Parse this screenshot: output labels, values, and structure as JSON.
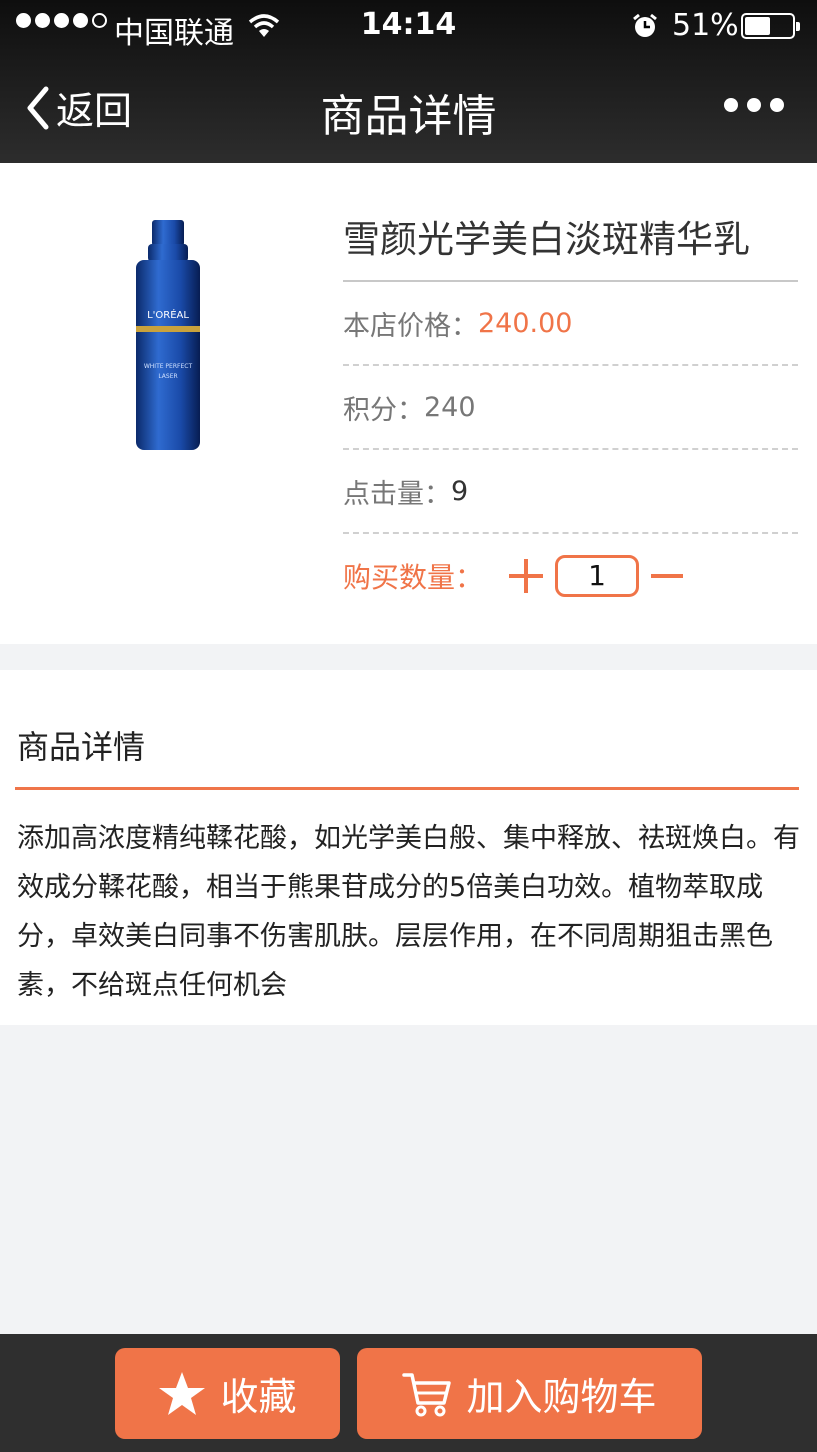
{
  "status_bar": {
    "carrier": "中国联通",
    "time": "14:14",
    "battery": "51%",
    "battery_level": 0.51
  },
  "nav": {
    "back_label": "返回",
    "title": "商品详情"
  },
  "product": {
    "name": "雪颜光学美白淡斑精华乳",
    "price_label": "本店价格：",
    "price_value": "240.00",
    "points_label": "积分：",
    "points_value": "240",
    "clicks_label": "点击量：",
    "clicks_value": "9",
    "qty_label": "购买数量：",
    "qty_value": "1",
    "image_brand": "L'ORÉAL",
    "image_line1": "WHITE PERFECT",
    "image_line2": "LASER"
  },
  "details": {
    "heading": "商品详情",
    "description": "添加高浓度精纯鞣花酸，如光学美白般、集中释放、祛斑焕白。有效成分鞣花酸，相当于熊果苷成分的5倍美白功效。植物萃取成分，卓效美白同事不伤害肌肤。层层作用，在不同周期狙击黑色素，不给斑点任何机会"
  },
  "actions": {
    "favorite_label": "收藏",
    "cart_label": "加入购物车"
  },
  "colors": {
    "accent": "#f07448",
    "bar": "#2f2f2f"
  }
}
